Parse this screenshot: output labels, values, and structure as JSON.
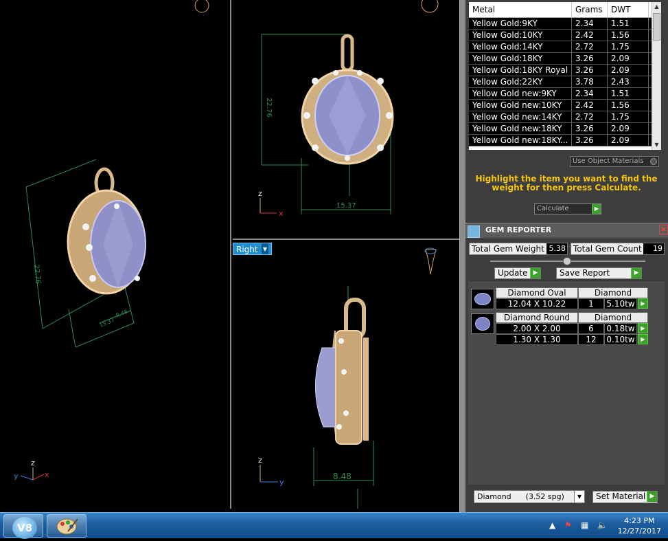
{
  "viewports": {
    "right_label": "Right",
    "persp_dims": {
      "height": "22.76",
      "depth": "8.48",
      "width": "15.37"
    },
    "front_dims": {
      "height": "22.76",
      "width": "15.37"
    },
    "right_dims": {
      "depth": "8.48"
    },
    "axes": {
      "persp": [
        "y",
        "z",
        "x"
      ],
      "front": [
        "z",
        "x"
      ],
      "right": [
        "z",
        "y"
      ]
    }
  },
  "metal_table": {
    "headers": [
      "Metal",
      "Grams",
      "DWT"
    ],
    "rows": [
      [
        "Yellow Gold:9KY",
        "2.34",
        "1.51"
      ],
      [
        "Yellow Gold:10KY",
        "2.42",
        "1.56"
      ],
      [
        "Yellow Gold:14KY",
        "2.72",
        "1.75"
      ],
      [
        "Yellow Gold:18KY",
        "3.26",
        "2.09"
      ],
      [
        "Yellow Gold:18KY Royal",
        "3.26",
        "2.09"
      ],
      [
        "Yellow Gold:22KY",
        "3.78",
        "2.43"
      ],
      [
        "Yellow Gold new:9KY",
        "2.34",
        "1.51"
      ],
      [
        "Yellow Gold new:10KY",
        "2.42",
        "1.56"
      ],
      [
        "Yellow Gold new:14KY",
        "2.72",
        "1.75"
      ],
      [
        "Yellow Gold new:18KY",
        "3.26",
        "2.09"
      ],
      [
        "Yellow Gold new:18KY...",
        "3.26",
        "2.09"
      ]
    ]
  },
  "use_object_materials": "Use Object Materials",
  "hint": "Highlight the item you want to find the weight for then press Calculate.",
  "calculate": "Calculate",
  "gem_reporter": {
    "title": "GEM REPORTER",
    "total_weight_label": "Total Gem Weight",
    "total_weight": "5.38",
    "total_count_label": "Total Gem Count",
    "total_count": "19",
    "update": "Update",
    "save_report": "Save Report",
    "groups": [
      {
        "shape": "Diamond Oval",
        "material": "Diamond",
        "rows": [
          {
            "size": "12.04 X 10.22",
            "count": "1",
            "weight": "5.10tw"
          }
        ]
      },
      {
        "shape": "Diamond Round",
        "material": "Diamond",
        "rows": [
          {
            "size": "2.00 X 2.00",
            "count": "6",
            "weight": "0.18tw"
          },
          {
            "size": "1.30 X 1.30",
            "count": "12",
            "weight": "0.10tw"
          }
        ]
      }
    ],
    "material_select": "Diamond      (3.52 spg)",
    "set_material": "Set Material"
  },
  "taskbar": {
    "start": "V8",
    "time": "4:23 PM",
    "date": "12/27/2017"
  },
  "colors": {
    "gold": "#d9b88a",
    "gem": "#8f90c8",
    "dim_line": "#3c8a5a",
    "accent_blue": "#1e8ecf"
  }
}
